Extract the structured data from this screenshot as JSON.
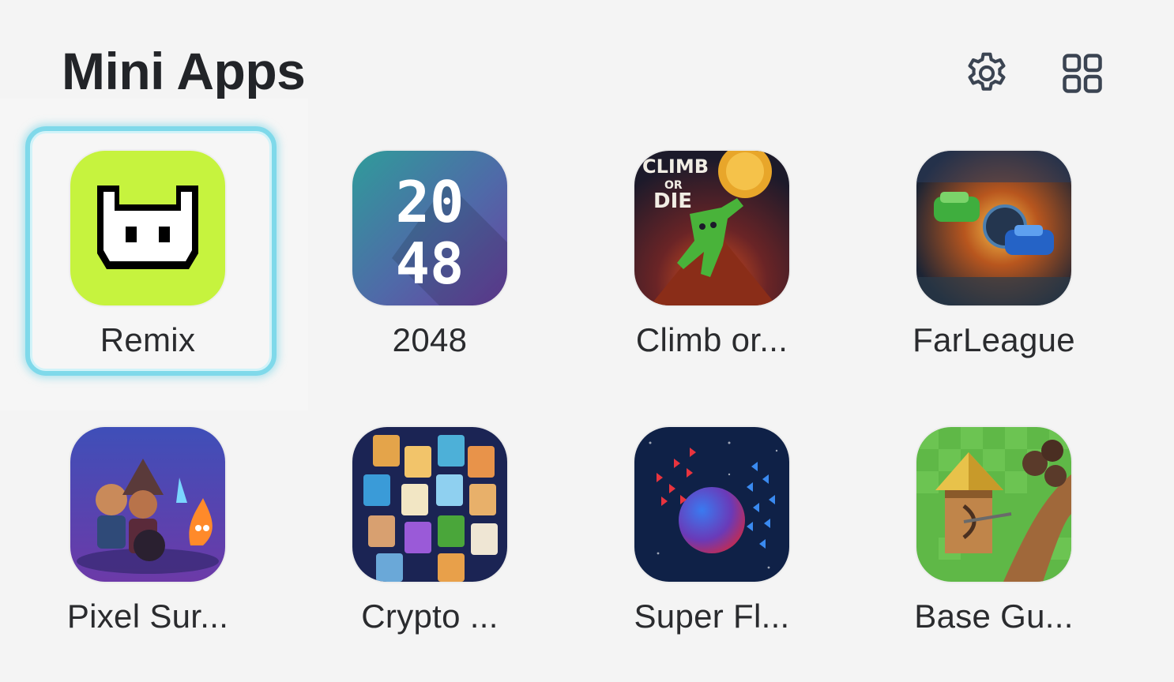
{
  "header": {
    "title": "Mini Apps",
    "settings_icon": "gear-icon",
    "layout_icon": "grid-icon"
  },
  "apps": [
    {
      "label": "Remix",
      "icon": "remix-logo",
      "selected": true,
      "bg": "#c5f23f"
    },
    {
      "label": "2048",
      "icon": "2048-game-icon",
      "selected": false,
      "bg": "#3f8ca0"
    },
    {
      "label": "Climb or...",
      "icon": "climb-or-die-game-icon",
      "selected": false,
      "bg": "#2a1f2a"
    },
    {
      "label": "FarLeague",
      "icon": "farleague-game-icon",
      "selected": false,
      "bg": "#1f2a3a"
    },
    {
      "label": "Pixel Sur...",
      "icon": "pixel-survivors-game-icon",
      "selected": false,
      "bg": "#4b3aa8"
    },
    {
      "label": "Crypto ...",
      "icon": "crypto-game-icon",
      "selected": false,
      "bg": "#1b2550"
    },
    {
      "label": "Super Fl...",
      "icon": "super-fl-game-icon",
      "selected": false,
      "bg": "#0f2147"
    },
    {
      "label": "Base Gu...",
      "icon": "base-gu-game-icon",
      "selected": false,
      "bg": "#5fb847"
    }
  ],
  "colors": {
    "selection_ring": "#7fd9ea",
    "background": "#f4f4f4"
  }
}
